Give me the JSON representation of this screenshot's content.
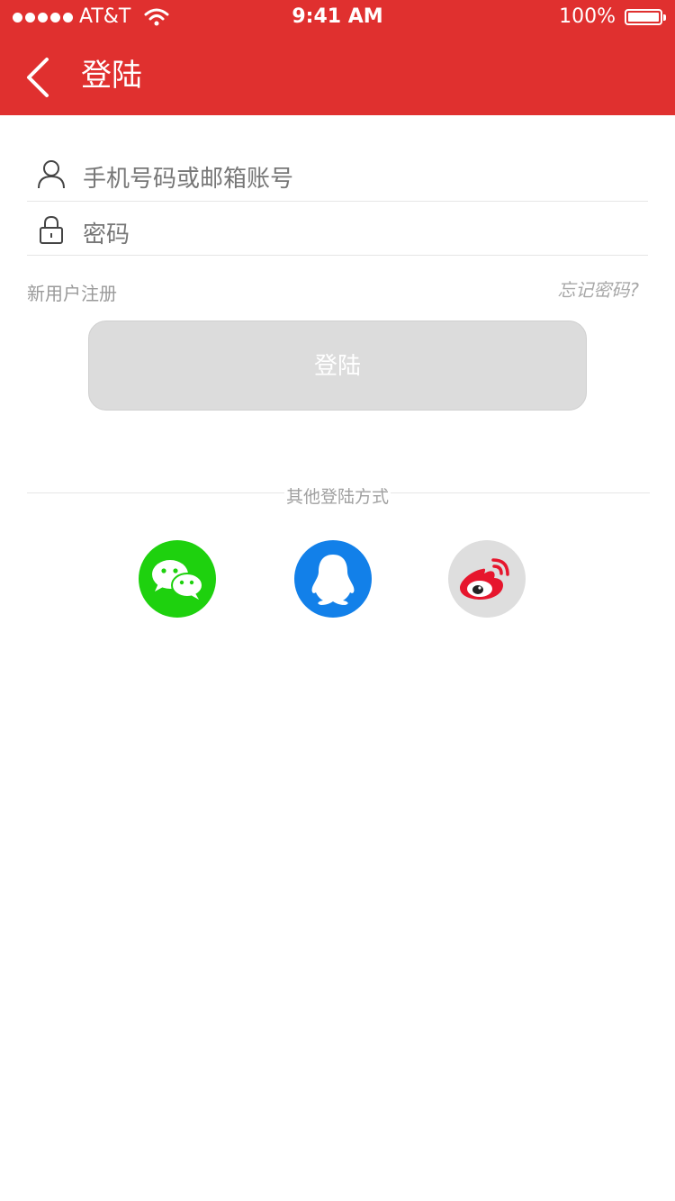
{
  "status_bar": {
    "carrier": "AT&T",
    "time": "9:41 AM",
    "battery": "100%"
  },
  "header": {
    "title": "登陆",
    "background_color": "#e0302f"
  },
  "form": {
    "account_placeholder": "手机号码或邮箱账号",
    "password_placeholder": "密码",
    "register_link": "新用户注册",
    "forgot_link": "忘记密码?",
    "login_button": "登陆"
  },
  "other_login": {
    "label": "其他登陆方式",
    "providers": [
      {
        "icon": "wechat-icon",
        "color": "#1ed10e"
      },
      {
        "icon": "qq-icon",
        "color": "#1280e9"
      },
      {
        "icon": "weibo-icon",
        "color": "#dedede"
      }
    ]
  }
}
